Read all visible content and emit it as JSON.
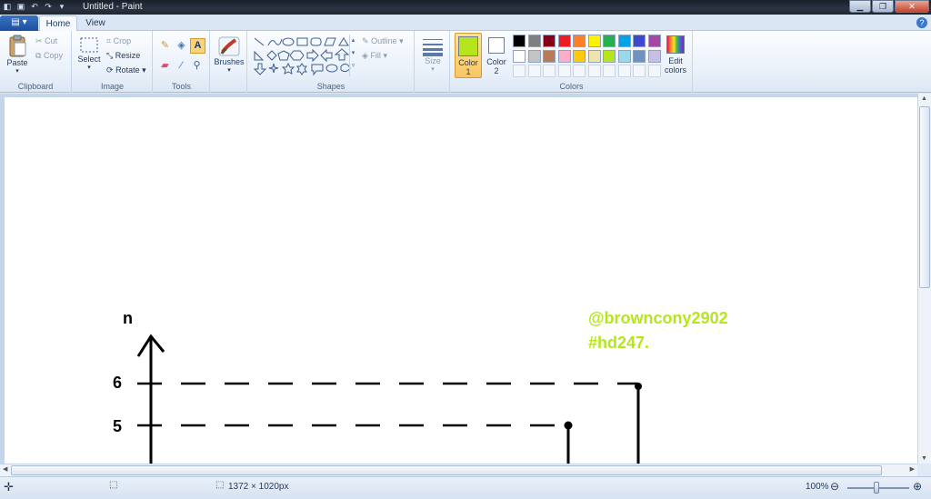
{
  "window": {
    "title": "Untitled - Paint"
  },
  "tabs": {
    "file": "▤ ▾",
    "home": "Home",
    "view": "View"
  },
  "help_glyph": "?",
  "ribbon": {
    "clipboard": {
      "label": "Clipboard",
      "paste": "Paste",
      "cut": "Cut",
      "copy": "Copy"
    },
    "image": {
      "label": "Image",
      "select": "Select",
      "crop": "Crop",
      "resize": "Resize",
      "rotate": "Rotate"
    },
    "tools": {
      "label": "Tools"
    },
    "brushes": {
      "label": "Brushes"
    },
    "shapes": {
      "label": "Shapes",
      "outline": "Outline",
      "fill": "Fill"
    },
    "size": {
      "label": "Size"
    },
    "colors": {
      "label": "Colors",
      "color1": "Color\n1",
      "color1_a": "Color",
      "color1_b": "1",
      "color2_a": "Color",
      "color2_b": "2",
      "edit_a": "Edit",
      "edit_b": "colors",
      "color1_value": "#b5e61d",
      "color2_value": "#ffffff",
      "palette_row1": [
        "#000000",
        "#7f7f7f",
        "#880015",
        "#ed1c24",
        "#ff7f27",
        "#fff200",
        "#22b14c",
        "#00a2e8",
        "#3f48cc",
        "#a349a4"
      ],
      "palette_row2": [
        "#ffffff",
        "#c3c3c3",
        "#b97a57",
        "#ffaec9",
        "#ffc90e",
        "#efe4b0",
        "#b5e61d",
        "#99d9ea",
        "#7092be",
        "#c8bfe7"
      ]
    }
  },
  "canvas": {
    "axis_label": "n",
    "tick_6": "6",
    "tick_5": "5",
    "watermark_line1": "@browncony2902",
    "watermark_line2": "#hd247.",
    "watermark_color": "#b5e61d"
  },
  "status": {
    "dimensions": "1372 × 1020px",
    "zoom": "100%"
  }
}
